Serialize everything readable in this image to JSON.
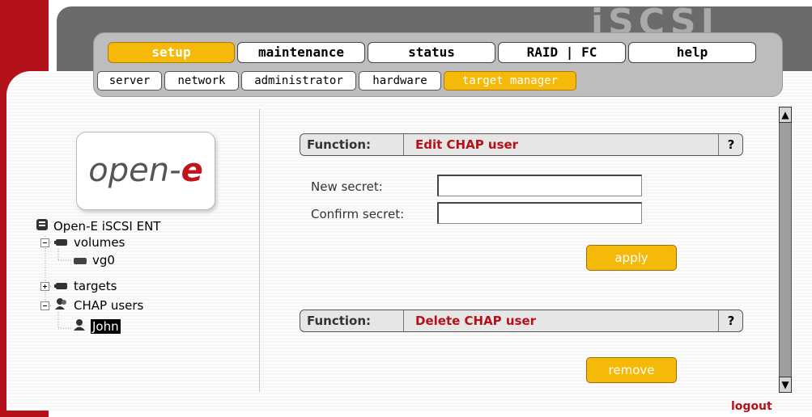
{
  "brand": "iSCSI",
  "main_tabs": [
    {
      "label": "setup",
      "active": true
    },
    {
      "label": "maintenance",
      "active": false
    },
    {
      "label": "status",
      "active": false
    },
    {
      "label": "RAID | FC",
      "active": false
    },
    {
      "label": "help",
      "active": false
    }
  ],
  "sub_tabs": [
    {
      "label": "server",
      "active": false
    },
    {
      "label": "network",
      "active": false
    },
    {
      "label": "administrator",
      "active": false
    },
    {
      "label": "hardware",
      "active": false
    },
    {
      "label": "target manager",
      "active": true
    }
  ],
  "logo": {
    "text_main": "open-",
    "text_accent": "e"
  },
  "tree": {
    "root": "Open-E iSCSI ENT",
    "volumes": "volumes",
    "vg0": "vg0",
    "targets": "targets",
    "chap_users": "CHAP users",
    "john": "John"
  },
  "edit_panel": {
    "function_label": "Function:",
    "title": "Edit CHAP user",
    "help": "?",
    "new_secret_label": "New secret:",
    "new_secret_value": "",
    "confirm_secret_label": "Confirm secret:",
    "confirm_secret_value": "",
    "apply_label": "apply"
  },
  "delete_panel": {
    "function_label": "Function:",
    "title": "Delete CHAP user",
    "help": "?",
    "remove_label": "remove"
  },
  "logout": "logout",
  "colors": {
    "accent": "#f5b90a",
    "brand_red": "#b3121a"
  }
}
